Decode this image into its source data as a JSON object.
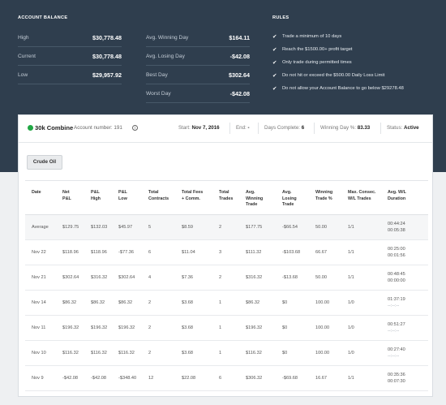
{
  "account_balance": {
    "title": "ACCOUNT BALANCE",
    "rows": [
      {
        "label": "High",
        "value": "$30,778.48"
      },
      {
        "label": "Current",
        "value": "$30,778.48"
      },
      {
        "label": "Low",
        "value": "$29,957.92"
      }
    ]
  },
  "day_stats": [
    {
      "label": "Avg. Winning Day",
      "value": "$164.11"
    },
    {
      "label": "Avg. Losing Day",
      "value": "-$42.08"
    },
    {
      "label": "Best Day",
      "value": "$302.64"
    },
    {
      "label": "Worst Day",
      "value": "-$42.08"
    }
  ],
  "rules": {
    "title": "RULES",
    "items": [
      "Trade a minimum of 10 days",
      "Reach the $1500.00+ profit target",
      "Only trade during permitted times",
      "Do not hit or exceed the $500.00 Daily Loss Limit",
      "Do not allow your Account Balance to go below $29278.48"
    ]
  },
  "panel": {
    "combine_name": "30k Combine",
    "account_number": "Account number: 191",
    "info_icon": "info-icon",
    "start_label": "Start:",
    "start_value": "Nov 7, 2016",
    "end_label": "End:",
    "end_value": "-",
    "days_label": "Days Complete:",
    "days_value": "6",
    "winday_label": "Winning Day %:",
    "winday_value": "83.33",
    "status_label": "Status:",
    "status_value": "Active",
    "tab_label": "Crude Oil",
    "status_dot_color": "#22a745"
  },
  "table": {
    "headers": [
      "Date",
      "Net\nP&L",
      "P&L\nHigh",
      "P&L\nLow",
      "Total\nContracts",
      "Total Fees\n+ Comm.",
      "Total\nTrades",
      "Avg.\nWinning\nTrade",
      "Avg.\nLosing\nTrade",
      "Winning\nTrade %",
      "Max. Consec.\nW/L Trades",
      "Avg. W/L\nDuration"
    ],
    "rows": [
      [
        "Average",
        "$129.75",
        "$132.03",
        "$45.97",
        "5",
        "$8.59",
        "2",
        "$177.75",
        "-$66.54",
        "50.00",
        "1/1",
        "00:44:24\n00:05:38"
      ],
      [
        "Nov 22",
        "$118.96",
        "$118.96",
        "-$77.36",
        "6",
        "$11.04",
        "3",
        "$111.32",
        "-$103.68",
        "66.67",
        "1/1",
        "00:25:00\n00:01:56"
      ],
      [
        "Nov 21",
        "$302.64",
        "$316.32",
        "$302.64",
        "4",
        "$7.36",
        "2",
        "$316.32",
        "-$13.68",
        "50.00",
        "1/1",
        "00:48:45\n00:00:00"
      ],
      [
        "Nov 14",
        "$86.32",
        "$86.32",
        "$86.32",
        "2",
        "$3.68",
        "1",
        "$86.32",
        "$0",
        "100.00",
        "1/0",
        "01:37:19\n--:--:--"
      ],
      [
        "Nov 11",
        "$196.32",
        "$196.32",
        "$196.32",
        "2",
        "$3.68",
        "1",
        "$196.32",
        "$0",
        "100.00",
        "1/0",
        "00:51:27\n--:--:--"
      ],
      [
        "Nov 10",
        "$116.32",
        "$116.32",
        "$116.32",
        "2",
        "$3.68",
        "1",
        "$116.32",
        "$0",
        "100.00",
        "1/0",
        "00:27:40\n--:--:--"
      ],
      [
        "Nov 9",
        "-$42.08",
        "-$42.08",
        "-$348.40",
        "12",
        "$22.08",
        "6",
        "$306.32",
        "-$69.68",
        "16.67",
        "1/1",
        "00:35:36\n00:07:30"
      ]
    ]
  }
}
